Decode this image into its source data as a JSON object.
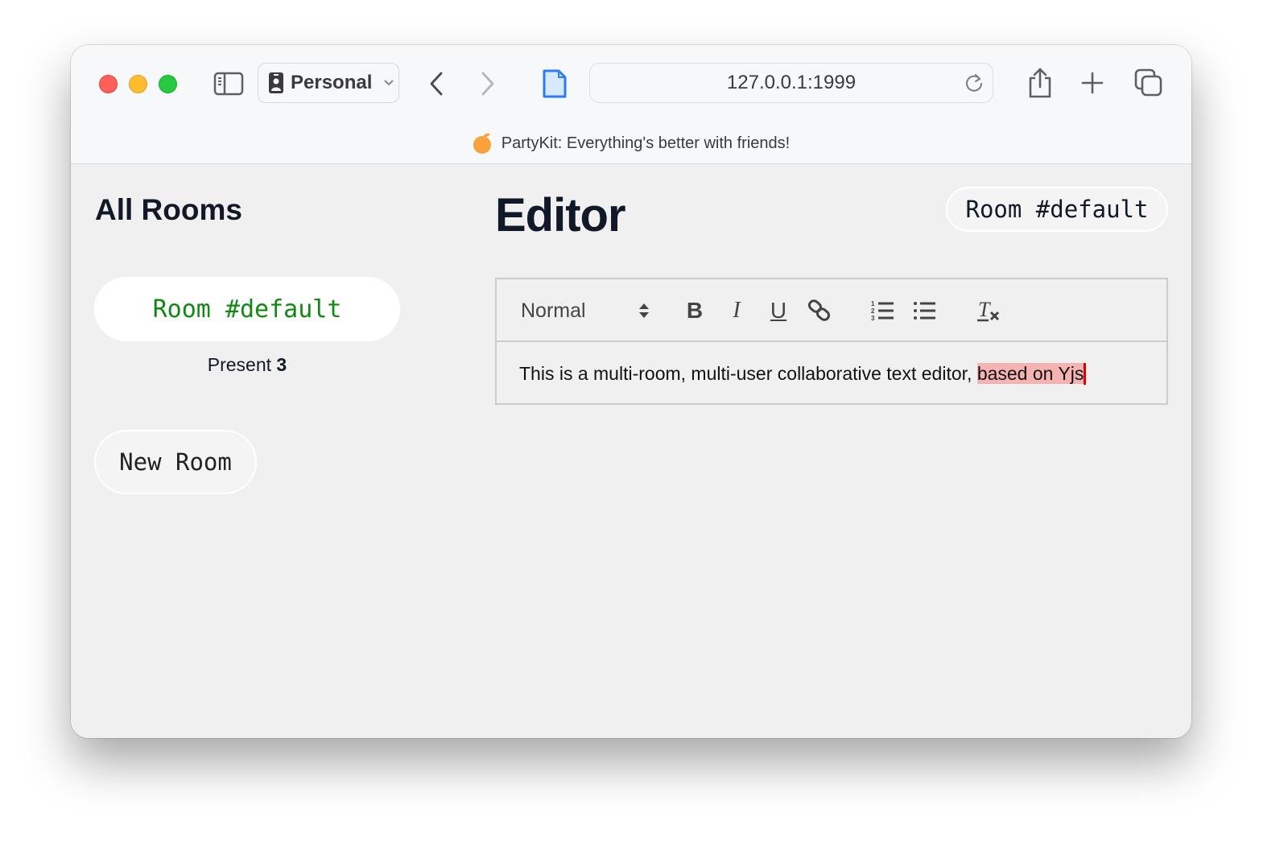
{
  "browser": {
    "profile_label": "Personal",
    "url": "127.0.0.1:1999",
    "banner_text": "PartyKit: Everything's better with friends!",
    "icons": {
      "sidebar": "sidebar-icon",
      "profile": "id-badge-icon",
      "back": "chevron-left-icon",
      "forward": "chevron-right-icon",
      "page": "document-icon",
      "reload": "reload-icon",
      "share": "share-icon",
      "new_tab": "plus-icon",
      "tab_overview": "tabs-icon",
      "banner": "orange-fruit-icon"
    }
  },
  "sidebar": {
    "title": "All Rooms",
    "rooms": [
      {
        "label": "Room #default",
        "present_label": "Present",
        "present_count": "3"
      }
    ],
    "new_room_label": "New Room"
  },
  "editor": {
    "title": "Editor",
    "room_badge": "Room #default",
    "toolbar": {
      "format_select": "Normal",
      "buttons": [
        "bold",
        "italic",
        "underline",
        "link",
        "ordered-list",
        "bullet-list",
        "clear-formatting"
      ],
      "bold_glyph": "B",
      "italic_glyph": "I",
      "underline_glyph": "U"
    },
    "content": {
      "text": "This is a multi-room, multi-user collaborative text editor, ",
      "remote_selection": "based on Yjs",
      "remote_cursor_color": "#e00000",
      "remote_selection_color": "#f5b3b1"
    }
  },
  "colors": {
    "room_link": "#118811",
    "heading": "#111827",
    "banner_icon": "#f9a23b"
  }
}
